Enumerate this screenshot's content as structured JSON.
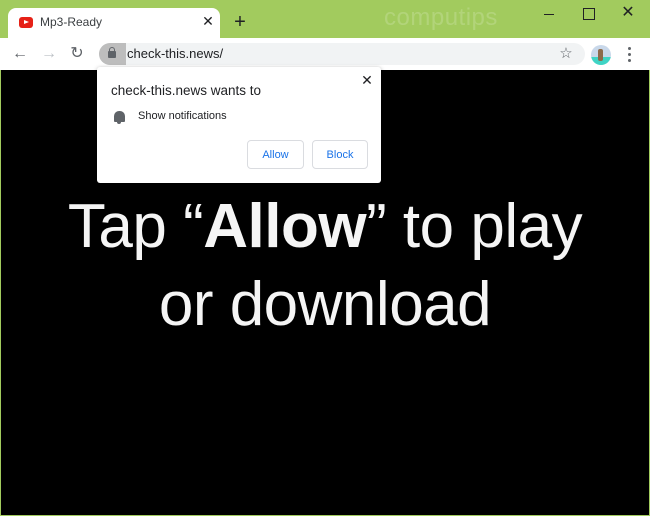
{
  "browser": {
    "tab": {
      "title": "Mp3-Ready",
      "favicon": "youtube-icon",
      "close_label": "✕"
    },
    "new_tab_label": "+",
    "watermark": "computips",
    "window_controls": {
      "minimize": "",
      "maximize": "",
      "close": "✕"
    },
    "nav": {
      "back": "←",
      "forward": "→",
      "reload": "↻"
    },
    "address_bar": {
      "url": "check-this.news/",
      "secure_icon": "lock-icon"
    },
    "bookmark_icon": "☆",
    "profile_icon": "avatar",
    "menu_icon": "kebab-menu-icon"
  },
  "permission_prompt": {
    "title": "check-this.news wants to",
    "permission": "Show notifications",
    "permission_icon": "bell-icon",
    "close_label": "✕",
    "allow_label": "Allow",
    "block_label": "Block"
  },
  "page": {
    "line1_pre": "Tap “",
    "line1_bold": "Allow",
    "line1_post": "” to play",
    "line2": "or download"
  },
  "colors": {
    "frame": "#a2cb5e",
    "page_background": "#000000",
    "button_text": "#1a73e8"
  }
}
